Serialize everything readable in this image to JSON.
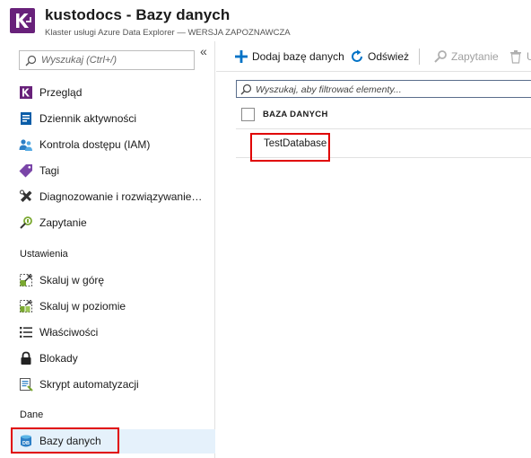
{
  "header": {
    "title": "kustodocs - Bazy danych",
    "subtitle": "Klaster usługi Azure Data Explorer — WERSJA ZAPOZNAWCZA",
    "logo_icon": "kusto-logo-icon",
    "logo_color": "#68217a"
  },
  "sidebar": {
    "search_placeholder": "Wyszukaj (Ctrl+/)",
    "collapse_glyph": "«",
    "items": [
      {
        "label": "Przegląd",
        "icon": "overview-icon"
      },
      {
        "label": "Dziennik aktywności",
        "icon": "activity-log-icon"
      },
      {
        "label": "Kontrola dostępu (IAM)",
        "icon": "access-control-icon"
      },
      {
        "label": "Tagi",
        "icon": "tag-icon"
      },
      {
        "label": "Diagnozowanie i rozwiązywanie…",
        "icon": "diagnose-icon"
      },
      {
        "label": "Zapytanie",
        "icon": "query-icon"
      }
    ],
    "section_settings": "Ustawienia",
    "settings_items": [
      {
        "label": "Skaluj w górę",
        "icon": "scale-up-icon"
      },
      {
        "label": "Skaluj w poziomie",
        "icon": "scale-out-icon"
      },
      {
        "label": "Właściwości",
        "icon": "properties-icon"
      },
      {
        "label": "Blokady",
        "icon": "lock-icon"
      },
      {
        "label": "Skrypt automatyzacji",
        "icon": "automation-script-icon"
      }
    ],
    "section_data": "Dane",
    "data_items": [
      {
        "label": "Bazy danych",
        "icon": "database-icon",
        "selected": true
      }
    ]
  },
  "toolbar": {
    "add_label": "Dodaj bazę danych",
    "refresh_label": "Odśwież",
    "query_label": "Zapytanie",
    "delete_label": "U"
  },
  "main": {
    "filter_placeholder": "Wyszukaj, aby filtrować elementy...",
    "column_header": "BAZA DANYCH",
    "rows": [
      "TestDatabase"
    ]
  },
  "colors": {
    "accent": "#0072c6",
    "highlight": "#e00000",
    "selected_bg": "#e5f1fb"
  }
}
